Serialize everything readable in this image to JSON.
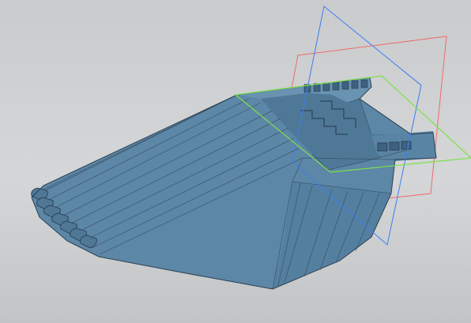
{
  "viewport": {
    "background_top": "#c9cbcd",
    "background_bottom": "#c2c4c6"
  },
  "model": {
    "name": "bucket-3d-model",
    "body_color": "#5d87a6",
    "body_shadow": "#4d7594",
    "body_highlight": "#6e97b4",
    "edge_color": "#2f4759",
    "tooth_count": 7
  },
  "planes": [
    {
      "name": "blue-plane",
      "color": "#3a7ef2"
    },
    {
      "name": "red-plane",
      "color": "#f06a6a"
    },
    {
      "name": "green-plane",
      "color": "#7ee24a"
    }
  ]
}
